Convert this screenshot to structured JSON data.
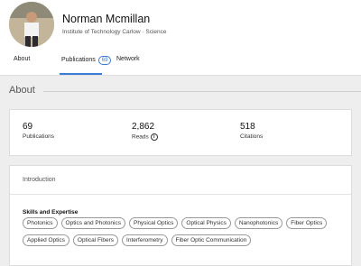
{
  "profile": {
    "name": "Norman Mcmillan",
    "affiliation": "Institute of Technology Carlow · Science"
  },
  "tabs": [
    {
      "label": "About"
    },
    {
      "label": "Publications",
      "count": "69"
    },
    {
      "label": "Network"
    }
  ],
  "about": {
    "heading": "About"
  },
  "stats": [
    {
      "value": "69",
      "label": "Publications"
    },
    {
      "value": "2,862",
      "label": "Reads"
    },
    {
      "value": "518",
      "label": "Citations"
    }
  ],
  "intro": {
    "title": "Introduction",
    "skills_title": "Skills and Expertise",
    "skills": [
      "Photonics",
      "Optics and Photonics",
      "Physical Optics",
      "Optical Physics",
      "Nanophotonics",
      "Fiber Optics",
      "Applied Optics",
      "Optical Fibers",
      "Interferometry",
      "Fiber Optic Communication"
    ]
  },
  "colors": {
    "accent": "#3c7bd6",
    "background": "#eeeeee"
  },
  "icons": {
    "reads_info": "info-icon"
  }
}
